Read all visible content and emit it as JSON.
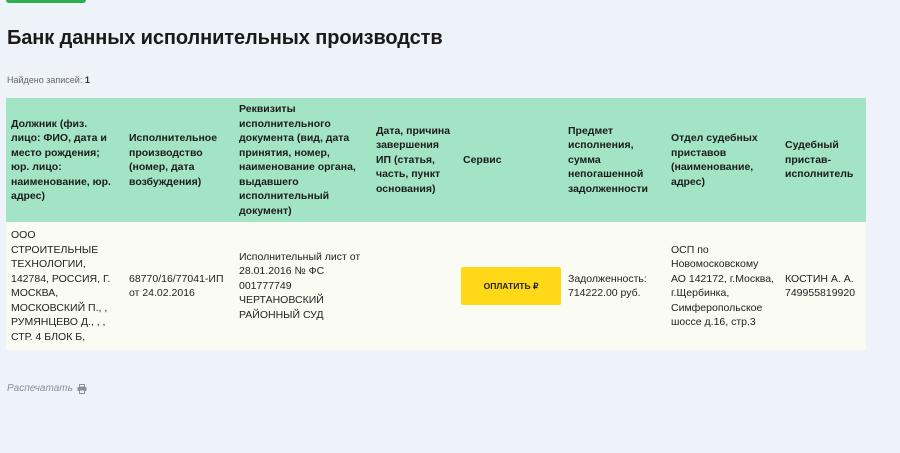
{
  "page": {
    "title": "Банк данных исполнительных производств",
    "found_label": "Найдено записей:",
    "found_count": "1",
    "print_label": "Распечатать"
  },
  "table": {
    "headers": [
      "Должник (физ. лицо: ФИО, дата и место рождения; юр. лицо: наименование, юр. адрес)",
      "Исполнительное производство (номер, дата возбуждения)",
      "Реквизиты исполнительного документа (вид, дата принятия, номер, наименование органа, выдавшего исполнительный документ)",
      "Дата, причина завершения ИП (статья, часть, пункт основания)",
      "Сервис",
      "Предмет исполнения, сумма непогашенной задолженности",
      "Отдел судебных приставов (наименование, адрес)",
      "Судебный пристав-исполнитель"
    ],
    "rows": [
      {
        "debtor": "ООО СТРОИТЕЛЬНЫЕ ТЕХНОЛОГИИ, 142784, РОССИЯ, Г. МОСКВА, МОСКОВСКИЙ П., , РУМЯНЦЕВО Д., , , СТР. 4 БЛОК Б,",
        "proceeding": "68770/16/77041-ИП от 24.02.2016",
        "document": "Исполнительный лист от 28.01.2016 № ФС 001777749 ЧЕРТАНОВСКИЙ РАЙОННЫЙ СУД",
        "completion": "",
        "service_button": "ОПЛАТИТЬ ₽",
        "subject": "Задолженность: 714222.00 руб.",
        "department": "ОСП по Новомосковскому АО 142172, г.Москва, г.Щербинка, Симферопольское шоссе д.16, стр.3",
        "bailiff": "КОСТИН А. А. 749955819920"
      }
    ]
  },
  "colors": {
    "header_bg": "#a2e4c4",
    "row_bg": "#fafbf3",
    "pay_button": "#ffd917",
    "page_bg": "#eef2f9"
  },
  "icons": {
    "print": "printer-icon"
  }
}
